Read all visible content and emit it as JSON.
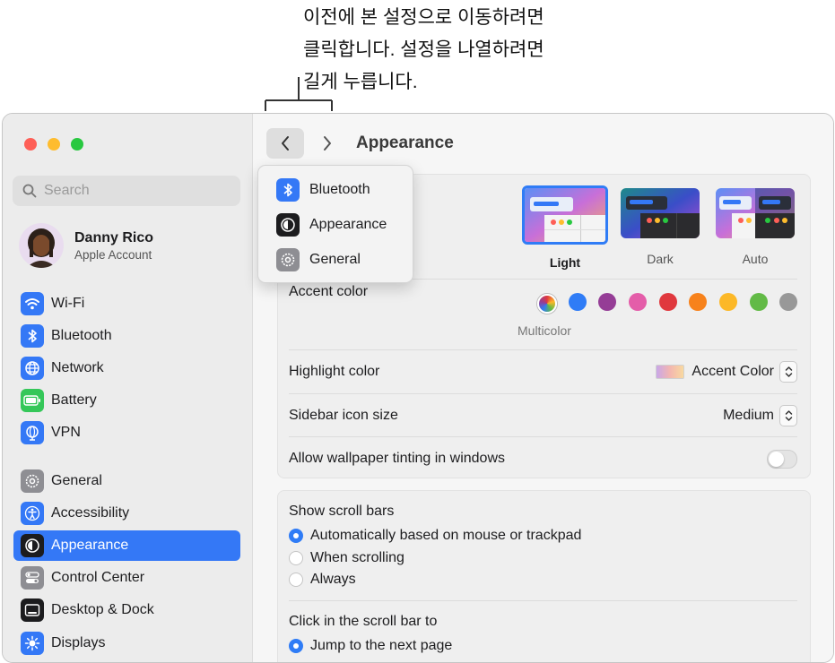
{
  "callout": {
    "lines": [
      "이전에 본 설정으로 이동하려면",
      "클릭합니다. 설정을 나열하려면",
      "길게 누릅니다."
    ]
  },
  "sidebar": {
    "search_placeholder": "Search",
    "profile": {
      "name": "Danny Rico",
      "subtitle": "Apple Account"
    },
    "items": [
      {
        "label": "Wi-Fi",
        "icon": "wifi-icon"
      },
      {
        "label": "Bluetooth",
        "icon": "bluetooth-icon"
      },
      {
        "label": "Network",
        "icon": "globe-icon"
      },
      {
        "label": "Battery",
        "icon": "battery-icon"
      },
      {
        "label": "VPN",
        "icon": "vpn-icon"
      },
      {
        "label": "General",
        "icon": "gear-icon"
      },
      {
        "label": "Accessibility",
        "icon": "accessibility-icon"
      },
      {
        "label": "Appearance",
        "icon": "appearance-icon",
        "selected": true
      },
      {
        "label": "Control Center",
        "icon": "control-center-icon"
      },
      {
        "label": "Desktop & Dock",
        "icon": "desktop-dock-icon"
      },
      {
        "label": "Displays",
        "icon": "sun-icon"
      }
    ]
  },
  "header": {
    "title": "Appearance"
  },
  "history_menu": {
    "items": [
      {
        "label": "Bluetooth",
        "icon": "bluetooth-icon"
      },
      {
        "label": "Appearance",
        "icon": "appearance-icon"
      },
      {
        "label": "General",
        "icon": "gear-icon"
      }
    ]
  },
  "appearance": {
    "themes": [
      {
        "label": "Light",
        "selected": true
      },
      {
        "label": "Dark"
      },
      {
        "label": "Auto"
      }
    ],
    "accent_label": "Accent color",
    "accent_selected_label": "Multicolor",
    "accent_colors": [
      "multicolor",
      "#2f7cf6",
      "#953d96",
      "#e45da9",
      "#e0383e",
      "#f7821b",
      "#fcb827",
      "#62ba46",
      "#989898"
    ],
    "highlight_label": "Highlight color",
    "highlight_value": "Accent Color",
    "sidebar_icon_label": "Sidebar icon size",
    "sidebar_icon_value": "Medium",
    "tinting_label": "Allow wallpaper tinting in windows",
    "tinting_enabled": false
  },
  "scroll": {
    "show_label": "Show scroll bars",
    "show_options": [
      {
        "label": "Automatically based on mouse or trackpad",
        "selected": true
      },
      {
        "label": "When scrolling",
        "selected": false
      },
      {
        "label": "Always",
        "selected": false
      }
    ],
    "click_label": "Click in the scroll bar to",
    "click_options": [
      {
        "label": "Jump to the next page",
        "selected": true
      }
    ]
  },
  "colors": {
    "accent": "#3478f6",
    "close": "#fe5f57",
    "minimize": "#febc2e",
    "zoom": "#28c840"
  }
}
